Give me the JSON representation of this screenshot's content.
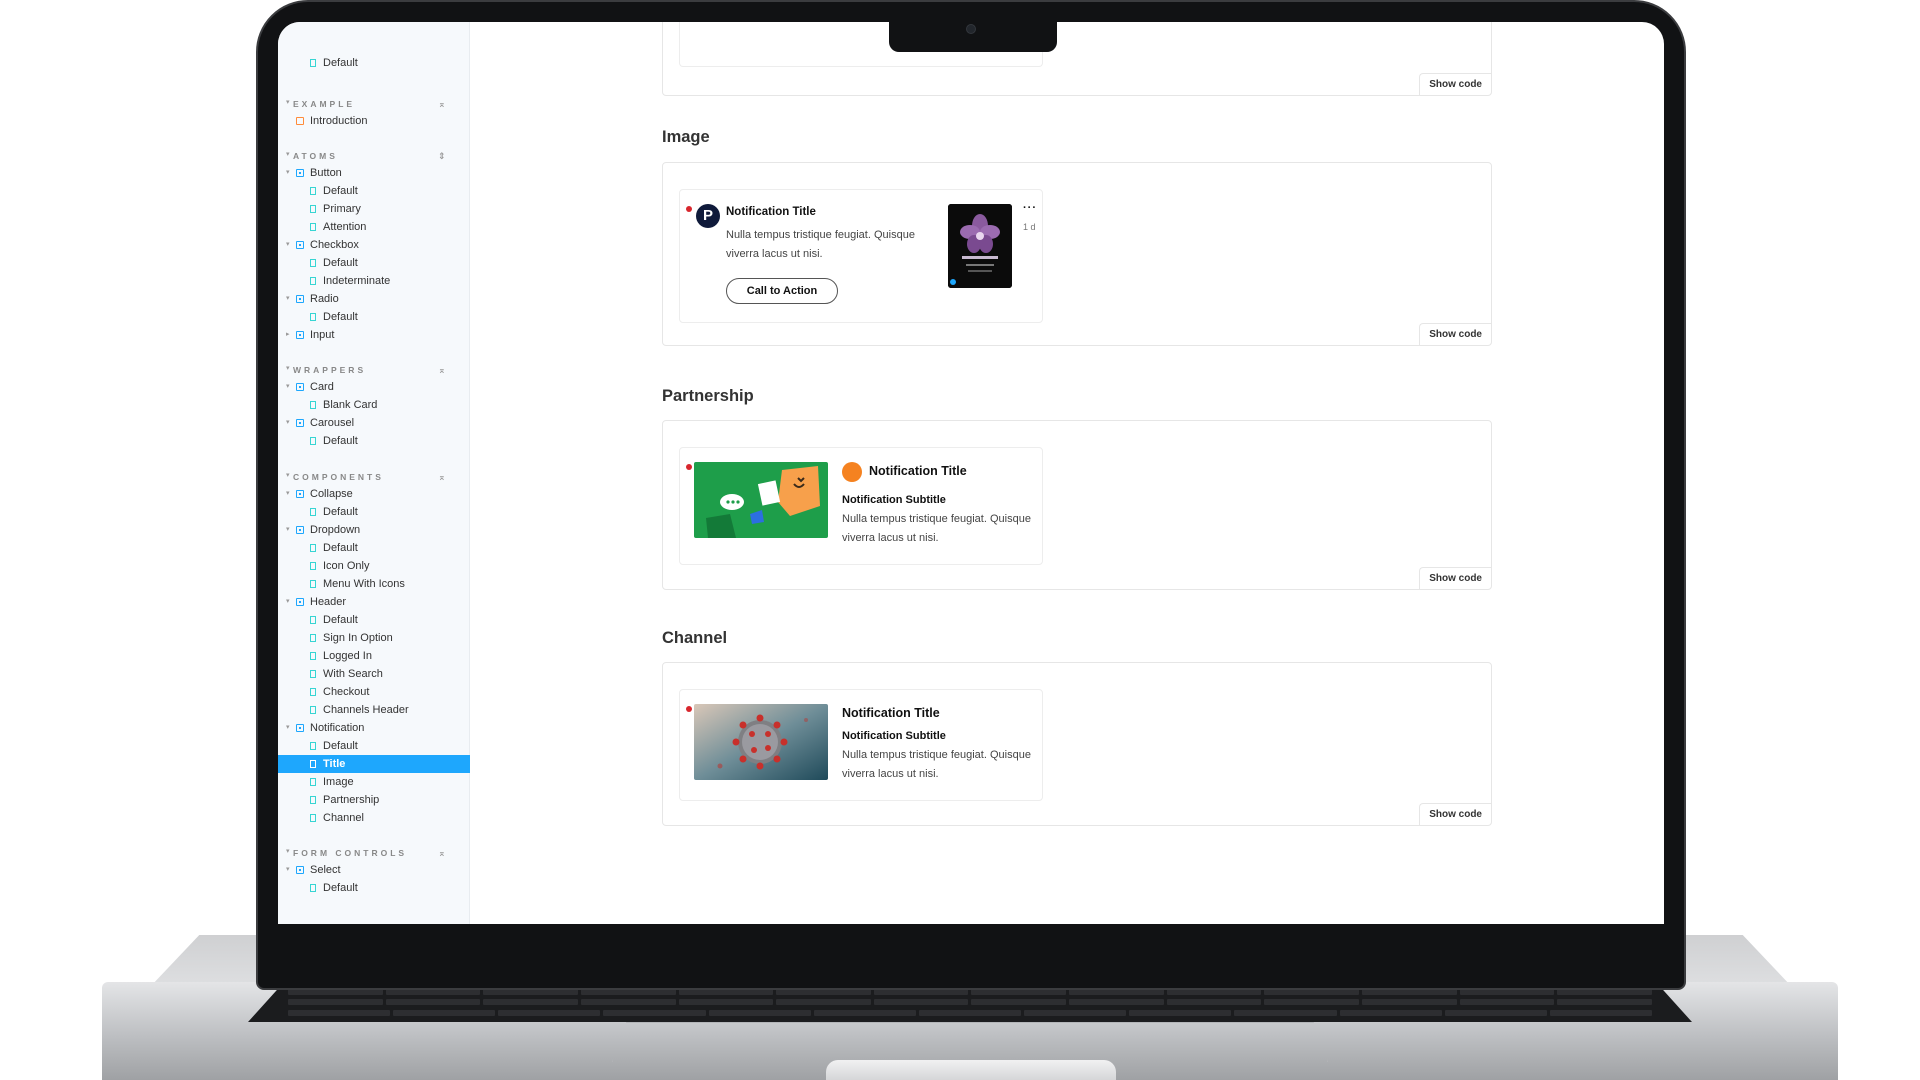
{
  "sidebar": {
    "top_story": "Default",
    "sections": {
      "example": "EXAMPLE",
      "atoms": "ATOMS",
      "wrappers": "WRAPPERS",
      "components": "COMPONENTS",
      "form_controls": "FORM CONTROLS"
    },
    "items": {
      "introduction": "Introduction",
      "button": "Button",
      "button_default": "Default",
      "button_primary": "Primary",
      "button_attention": "Attention",
      "checkbox": "Checkbox",
      "checkbox_default": "Default",
      "checkbox_indeterminate": "Indeterminate",
      "radio": "Radio",
      "radio_default": "Default",
      "input": "Input",
      "card": "Card",
      "card_blank": "Blank Card",
      "carousel": "Carousel",
      "carousel_default": "Default",
      "collapse": "Collapse",
      "collapse_default": "Default",
      "dropdown": "Dropdown",
      "dropdown_default": "Default",
      "dropdown_icon_only": "Icon Only",
      "dropdown_menu_with_icons": "Menu With Icons",
      "header": "Header",
      "header_default": "Default",
      "header_sign_in": "Sign In Option",
      "header_logged_in": "Logged In",
      "header_with_search": "With Search",
      "header_checkout": "Checkout",
      "header_channels": "Channels Header",
      "notification": "Notification",
      "notification_default": "Default",
      "notification_title": "Title",
      "notification_image": "Image",
      "notification_partnership": "Partnership",
      "notification_channel": "Channel",
      "select": "Select",
      "select_default": "Default"
    },
    "selected_color": "#1ea7fd"
  },
  "main": {
    "show_code_label": "Show code",
    "sections": {
      "image": {
        "title": "Image",
        "notification": {
          "title": "Notification Title",
          "body": "Nulla tempus tristique feugiat. Quisque viverra lacus ut nisi.",
          "cta": "Call to Action",
          "logo_letter": "P",
          "time": "1 d",
          "more": "···"
        }
      },
      "partnership": {
        "title": "Partnership",
        "notification": {
          "title": "Notification Title",
          "subtitle": "Notification Subtitle",
          "body": "Nulla tempus tristique feugiat. Quisque viverra lacus ut nisi."
        }
      },
      "channel": {
        "title": "Channel",
        "notification": {
          "title": "Notification Title",
          "subtitle": "Notification Subtitle",
          "body": "Nulla tempus tristique feugiat. Quisque viverra lacus ut nisi."
        }
      }
    }
  },
  "colors": {
    "accent": "#1ea7fd",
    "unread_dot": "#d8262d",
    "partner_badge": "#f58220",
    "partner_image_bg": "#1e9e4a"
  }
}
